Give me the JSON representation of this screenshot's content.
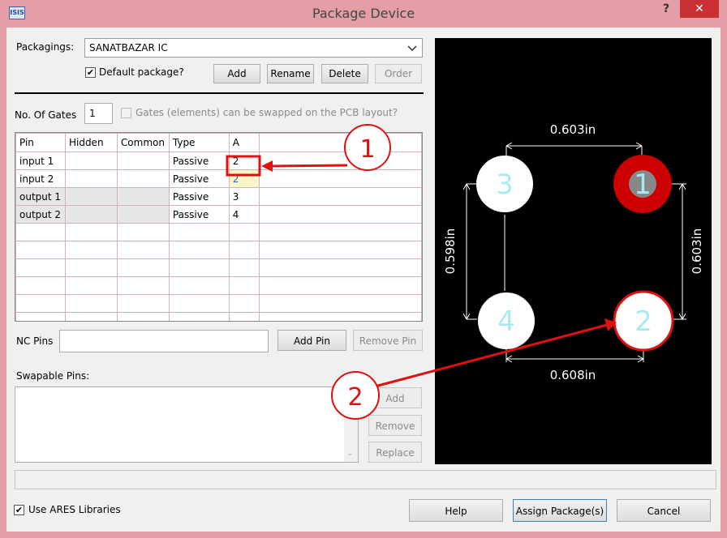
{
  "window": {
    "title": "Package Device",
    "help_glyph": "?",
    "close_glyph": "✕",
    "app_icon": "ISIS"
  },
  "packagings": {
    "label": "Packagings:",
    "value": "SANATBAZAR IC",
    "default_label": "Default package?",
    "default_checked": true,
    "buttons": {
      "add": "Add",
      "rename": "Rename",
      "delete": "Delete",
      "order": "Order"
    }
  },
  "gates": {
    "label": "No. Of Gates",
    "value": "1",
    "swap_label": "Gates (elements) can be swapped on the PCB layout?"
  },
  "pin_table": {
    "columns": [
      "Pin",
      "Hidden",
      "Common",
      "Type",
      "A"
    ],
    "rows": [
      {
        "pin": "input 1",
        "hidden": "",
        "common": "",
        "type": "Passive",
        "a": "2"
      },
      {
        "pin": "input 2",
        "hidden": "",
        "common": "",
        "type": "Passive",
        "a": "2"
      },
      {
        "pin": "output 1",
        "hidden": "",
        "common": "",
        "type": "Passive",
        "a": "3"
      },
      {
        "pin": "output 2",
        "hidden": "",
        "common": "",
        "type": "Passive",
        "a": "4"
      }
    ]
  },
  "nc_pins": {
    "label": "NC Pins",
    "value": "",
    "add_pin": "Add Pin",
    "remove_pin": "Remove Pin"
  },
  "swapable": {
    "label": "Swapable Pins:",
    "buttons": {
      "add": "Add",
      "remove": "Remove",
      "replace": "Replace"
    }
  },
  "footer": {
    "use_ares_label": "Use ARES Libraries",
    "use_ares_checked": true,
    "help": "Help",
    "assign": "Assign Package(s)",
    "cancel": "Cancel"
  },
  "preview": {
    "pad_labels": [
      "1",
      "2",
      "3",
      "4"
    ],
    "dim_top": "0.603in",
    "dim_bottom": "0.608in",
    "dim_left": "0.598in",
    "dim_right": "0.603in"
  },
  "annotations": {
    "marker_1": "1",
    "marker_2": "2"
  },
  "colors": {
    "title_bar": "#e49ea6",
    "close": "#c93033",
    "pad_fill": "#ffffff",
    "pad_label": "#a8eaf2",
    "pin1_ring": "#cc0000",
    "annotation": "#e01010",
    "dimension": "#ffffff"
  }
}
